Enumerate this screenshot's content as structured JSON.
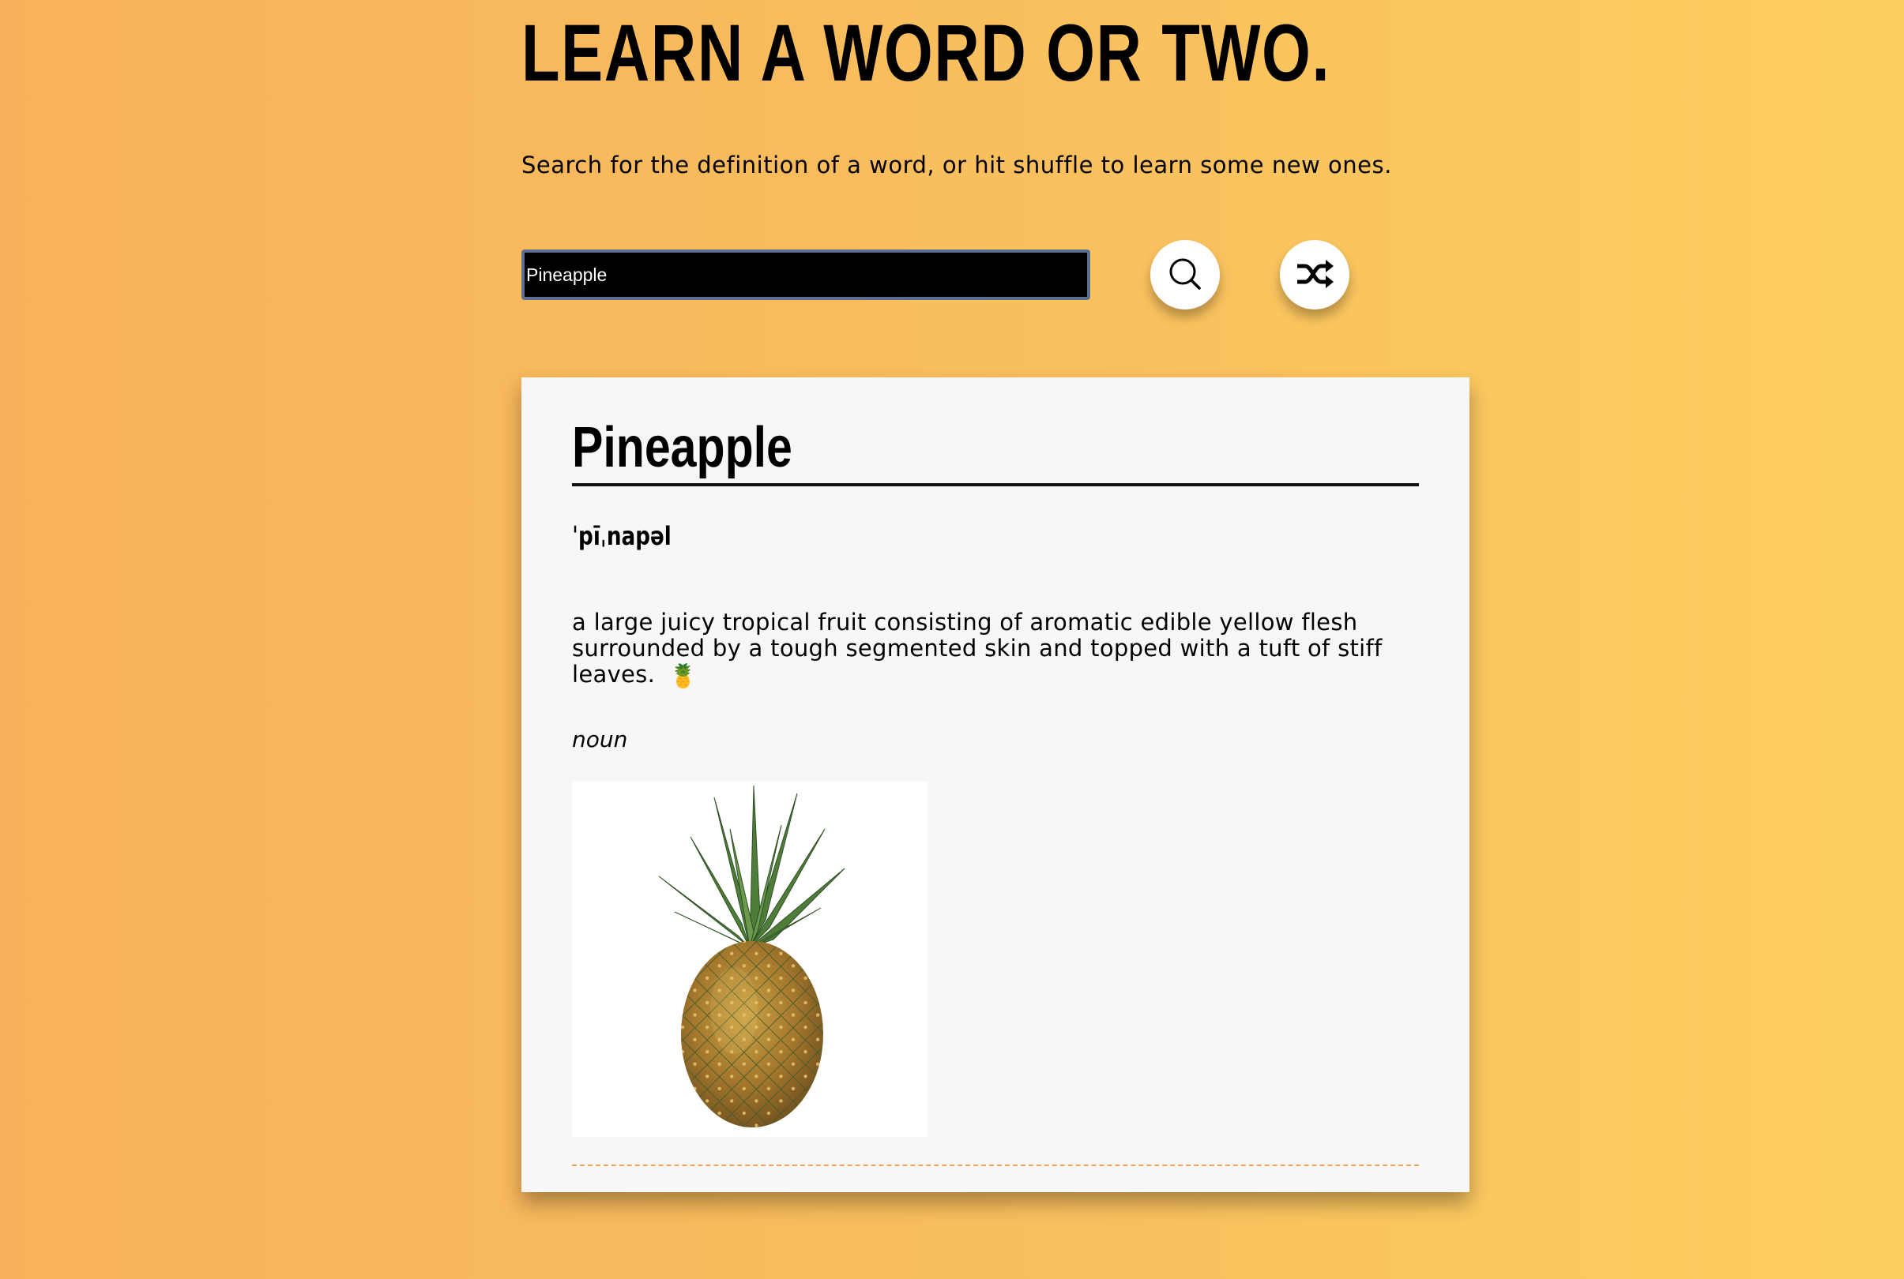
{
  "header": {
    "title": "LEARN A WORD OR TWO.",
    "subtitle": "Search for the definition of a word, or hit shuffle to learn some new ones."
  },
  "search": {
    "value": "Pineapple",
    "search_icon": "search-icon",
    "shuffle_icon": "shuffle-icon"
  },
  "result": {
    "word": "Pineapple",
    "phonetic": "ˈpīˌnapəl",
    "definition": "a large juicy tropical fruit consisting of aromatic edible yellow flesh surrounded by a tough segmented skin and topped with a tuft of stiff leaves.",
    "emoji": "🍍",
    "part_of_speech": "noun",
    "image": "pineapple-image"
  },
  "colors": {
    "background_start": "#f7b15a",
    "background_end": "#fcce60",
    "input_background": "#000000",
    "input_border": "#5a6f8f",
    "card_background": "#f7f7f7",
    "dashed_rule": "#f2a25a"
  }
}
